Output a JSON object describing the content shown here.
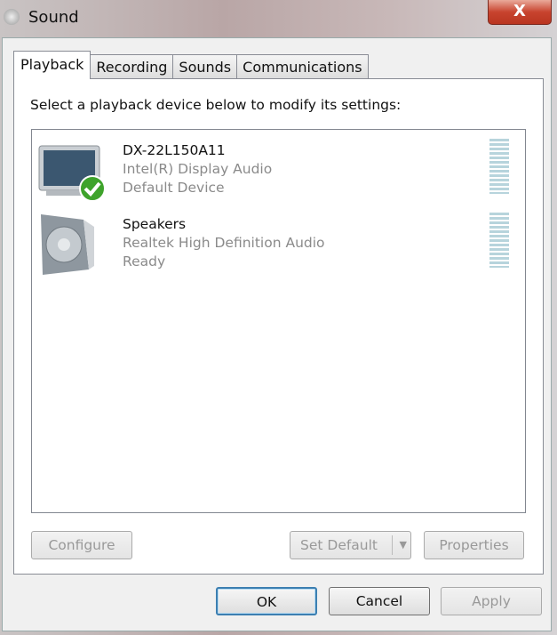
{
  "window": {
    "title": "Sound",
    "close_label": "X"
  },
  "tabs": [
    {
      "label": "Playback",
      "active": true
    },
    {
      "label": "Recording"
    },
    {
      "label": "Sounds"
    },
    {
      "label": "Communications"
    }
  ],
  "playback": {
    "instruction": "Select a playback device below to modify its settings:",
    "devices": [
      {
        "name": "DX-22L150A11",
        "driver": "Intel(R) Display Audio",
        "status": "Default Device",
        "icon": "monitor-icon",
        "default": true
      },
      {
        "name": "Speakers",
        "driver": "Realtek High Definition Audio",
        "status": "Ready",
        "icon": "speaker-icon"
      }
    ],
    "configure_label": "Configure",
    "set_default_label": "Set Default",
    "properties_label": "Properties"
  },
  "footer": {
    "ok_label": "OK",
    "cancel_label": "Cancel",
    "apply_label": "Apply"
  }
}
